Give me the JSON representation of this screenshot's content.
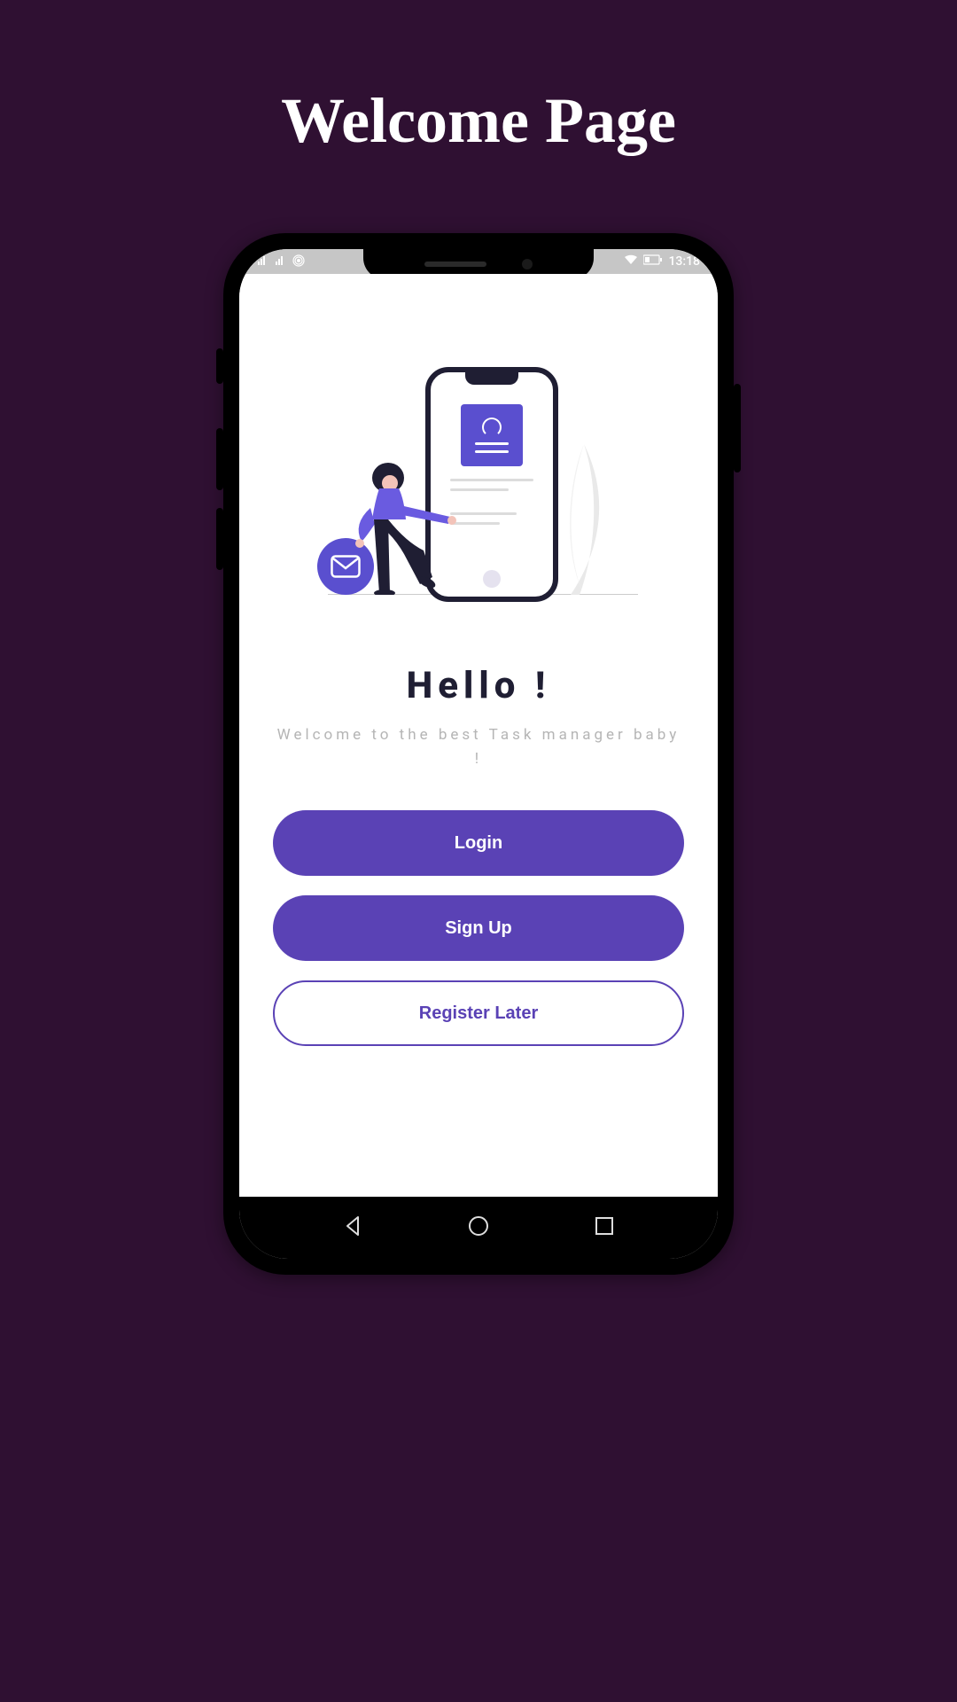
{
  "page": {
    "title": "Welcome Page"
  },
  "statusBar": {
    "time": "13:18"
  },
  "welcome": {
    "headline": "Hello !",
    "subtitle": "Welcome to the best Task manager baby !"
  },
  "buttons": {
    "login": "Login",
    "signup": "Sign Up",
    "later": "Register Later"
  },
  "colors": {
    "accent": "#5a42b5",
    "illustration": "#5a4fcf",
    "background": "#2f1032"
  },
  "icons": {
    "mail": "mail-icon",
    "profile": "profile-icon",
    "back": "back-icon",
    "home": "home-icon",
    "recent": "recent-icon",
    "signal": "signal-icon",
    "hotspot": "hotspot-icon",
    "wifi": "wifi-icon",
    "battery": "battery-icon"
  }
}
